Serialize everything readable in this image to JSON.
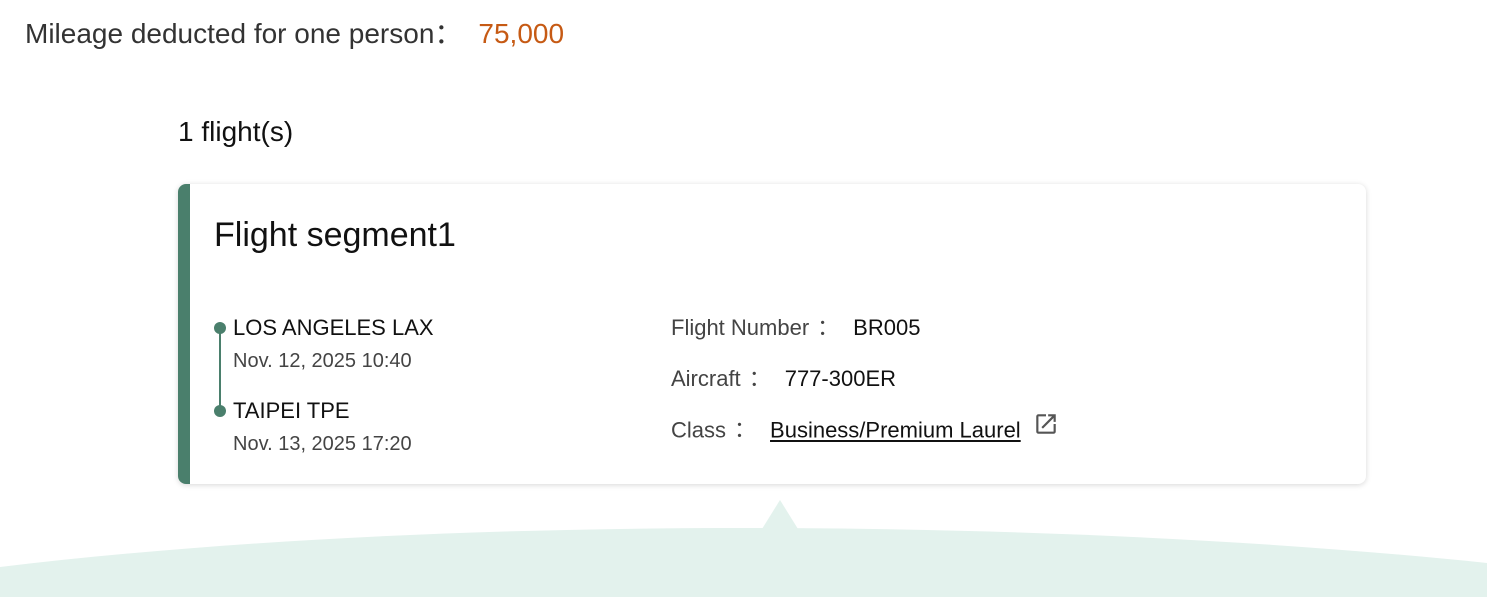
{
  "summary": {
    "mileage_label": "Mileage deducted for one person：",
    "mileage_value": "75,000",
    "flight_count": "1 flight(s)"
  },
  "segment": {
    "title": "Flight segment1",
    "departure": {
      "city": "LOS ANGELES LAX",
      "time": "Nov. 12, 2025 10:40"
    },
    "arrival": {
      "city": "TAIPEI TPE",
      "time": "Nov. 13, 2025 17:20"
    },
    "flight_number_label": "Flight Number",
    "flight_number": "BR005",
    "aircraft_label": "Aircraft",
    "aircraft": "777-300ER",
    "class_label": "Class",
    "class_value": "Business/Premium Laurel",
    "separator": "："
  },
  "icons": {
    "class_link_icon": "external-link-icon"
  },
  "colors": {
    "accent": "#4a7f6c",
    "mileage": "#c65a14",
    "wave": "#e3f2ed"
  }
}
